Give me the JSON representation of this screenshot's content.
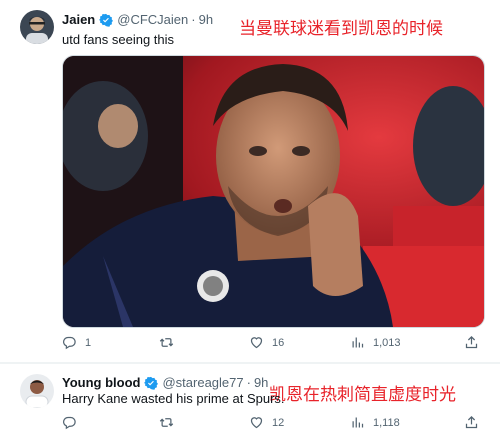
{
  "tweets": [
    {
      "author_name": "Jaien",
      "author_handle": "@CFCJaien",
      "separator": "·",
      "time": "9h",
      "text": "utd fans seeing this",
      "overlay_caption": "当曼联球迷看到凯恩的时候",
      "overlay_color": "#e8232a",
      "has_media": true,
      "stats": {
        "replies": "1",
        "retweets": "",
        "likes": "16",
        "views": "1,013"
      }
    },
    {
      "author_name": "Young blood",
      "author_handle": "@stareagle77",
      "separator": "·",
      "time": "9h",
      "text": "Harry Kane wasted his prime at Spurs.",
      "overlay_caption": "凯恩在热刺简直虚度时光",
      "overlay_color": "#e8232a",
      "has_media": false,
      "stats": {
        "replies": "",
        "retweets": "",
        "likes": "12",
        "views": "1,118"
      }
    }
  ],
  "icons": [
    "verified-badge-icon",
    "reply-icon",
    "retweet-icon",
    "like-icon",
    "views-icon",
    "share-icon"
  ],
  "colors": {
    "verified": "#1d9bf0",
    "muted": "#536471",
    "text": "#0f1419"
  }
}
